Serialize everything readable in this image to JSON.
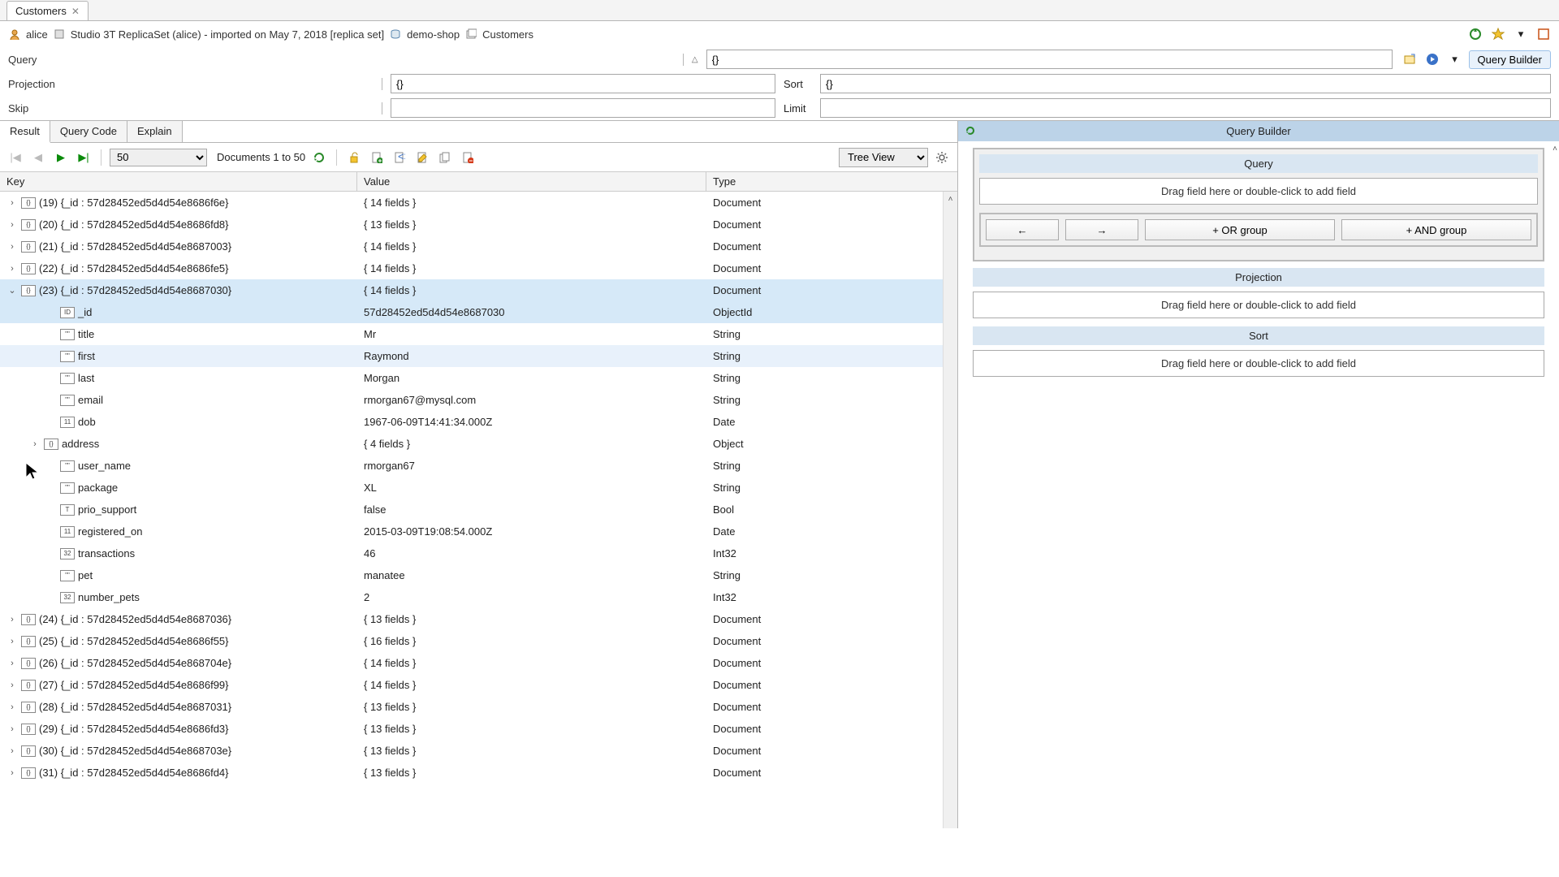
{
  "tab": {
    "title": "Customers"
  },
  "breadcrumb": {
    "user": "alice",
    "connection": "Studio 3T ReplicaSet (alice) - imported on May 7, 2018 [replica set]",
    "database": "demo-shop",
    "collection": "Customers"
  },
  "query": {
    "label": "Query",
    "value": "{}",
    "projection_label": "Projection",
    "projection_value": "{}",
    "sort_label": "Sort",
    "sort_value": "{}",
    "skip_label": "Skip",
    "skip_value": "",
    "limit_label": "Limit",
    "limit_value": "",
    "builder_btn": "Query Builder"
  },
  "sub_tabs": {
    "result": "Result",
    "code": "Query Code",
    "explain": "Explain"
  },
  "results": {
    "page_size": "50",
    "count_text": "Documents 1 to 50",
    "view_mode": "Tree View"
  },
  "columns": {
    "key": "Key",
    "value": "Value",
    "type": "Type"
  },
  "docs": [
    {
      "idx": "(19)",
      "id": "57d28452ed5d4d54e8686f6e",
      "fields": "{ 14 fields }",
      "type": "Document"
    },
    {
      "idx": "(20)",
      "id": "57d28452ed5d4d54e8686fd8",
      "fields": "{ 13 fields }",
      "type": "Document"
    },
    {
      "idx": "(21)",
      "id": "57d28452ed5d4d54e8687003",
      "fields": "{ 14 fields }",
      "type": "Document"
    },
    {
      "idx": "(22)",
      "id": "57d28452ed5d4d54e8686fe5",
      "fields": "{ 14 fields }",
      "type": "Document"
    },
    {
      "idx": "(23)",
      "id": "57d28452ed5d4d54e8687030",
      "fields": "{ 14 fields }",
      "type": "Document",
      "expanded": true
    },
    {
      "idx": "(24)",
      "id": "57d28452ed5d4d54e8687036",
      "fields": "{ 13 fields }",
      "type": "Document"
    },
    {
      "idx": "(25)",
      "id": "57d28452ed5d4d54e8686f55",
      "fields": "{ 16 fields }",
      "type": "Document"
    },
    {
      "idx": "(26)",
      "id": "57d28452ed5d4d54e868704e",
      "fields": "{ 14 fields }",
      "type": "Document"
    },
    {
      "idx": "(27)",
      "id": "57d28452ed5d4d54e8686f99",
      "fields": "{ 14 fields }",
      "type": "Document"
    },
    {
      "idx": "(28)",
      "id": "57d28452ed5d4d54e8687031",
      "fields": "{ 13 fields }",
      "type": "Document"
    },
    {
      "idx": "(29)",
      "id": "57d28452ed5d4d54e8686fd3",
      "fields": "{ 13 fields }",
      "type": "Document"
    },
    {
      "idx": "(30)",
      "id": "57d28452ed5d4d54e868703e",
      "fields": "{ 13 fields }",
      "type": "Document"
    },
    {
      "idx": "(31)",
      "id": "57d28452ed5d4d54e8686fd4",
      "fields": "{ 13 fields }",
      "type": "Document"
    }
  ],
  "expanded_fields": [
    {
      "key": "_id",
      "value": "57d28452ed5d4d54e8687030",
      "type": "ObjectId",
      "badge": "ID",
      "selected": true
    },
    {
      "key": "title",
      "value": "Mr",
      "type": "String",
      "badge": "\"\""
    },
    {
      "key": "first",
      "value": "Raymond",
      "type": "String",
      "badge": "\"\"",
      "hover": true
    },
    {
      "key": "last",
      "value": "Morgan",
      "type": "String",
      "badge": "\"\""
    },
    {
      "key": "email",
      "value": "rmorgan67@mysql.com",
      "type": "String",
      "badge": "\"\""
    },
    {
      "key": "dob",
      "value": "1967-06-09T14:41:34.000Z",
      "type": "Date",
      "badge": "11"
    },
    {
      "key": "address",
      "value": "{ 4 fields }",
      "type": "Object",
      "badge": "{}",
      "expandable": true
    },
    {
      "key": "user_name",
      "value": "rmorgan67",
      "type": "String",
      "badge": "\"\""
    },
    {
      "key": "package",
      "value": "XL",
      "type": "String",
      "badge": "\"\""
    },
    {
      "key": "prio_support",
      "value": "false",
      "type": "Bool",
      "badge": "T"
    },
    {
      "key": "registered_on",
      "value": "2015-03-09T19:08:54.000Z",
      "type": "Date",
      "badge": "11"
    },
    {
      "key": "transactions",
      "value": "46",
      "type": "Int32",
      "badge": "32"
    },
    {
      "key": "pet",
      "value": "manatee",
      "type": "String",
      "badge": "\"\""
    },
    {
      "key": "number_pets",
      "value": "2",
      "type": "Int32",
      "badge": "32"
    }
  ],
  "qb": {
    "title": "Query Builder",
    "query_head": "Query",
    "drop_hint": "Drag field here or double-click to add field",
    "indent_btn": "←",
    "outdent_btn": "→",
    "or_btn": "+  OR group",
    "and_btn": "+  AND group",
    "projection_head": "Projection",
    "sort_head": "Sort"
  }
}
